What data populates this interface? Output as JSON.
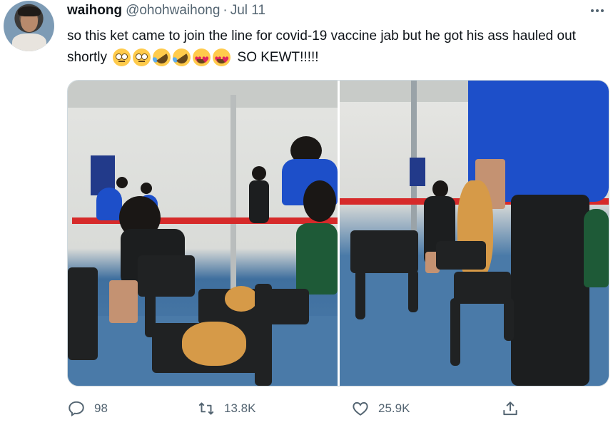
{
  "tweet": {
    "display_name": "waihong",
    "handle": "@ohohwaihong",
    "separator": "·",
    "date": "Jul 11",
    "text_main": "so this ket came to join the line for covid-19 vaccine jab but he got his ass hauled out shortly",
    "text_tail": "SO KEWT!!!!!",
    "emojis": [
      "rolling-eyes-icon",
      "rolling-eyes-icon",
      "rofl-icon",
      "rofl-icon",
      "heart-eyes-icon",
      "heart-eyes-icon"
    ],
    "media": [
      {
        "name": "photo-cat-in-chair",
        "description_icon": "photo"
      },
      {
        "name": "photo-cat-carried",
        "description_icon": "photo"
      }
    ]
  },
  "actions": {
    "reply_count": "98",
    "retweet_count": "13.8K",
    "like_count": "25.9K"
  },
  "colors": {
    "text": "#0f1419",
    "secondary": "#536471",
    "border": "#cfd9de"
  }
}
